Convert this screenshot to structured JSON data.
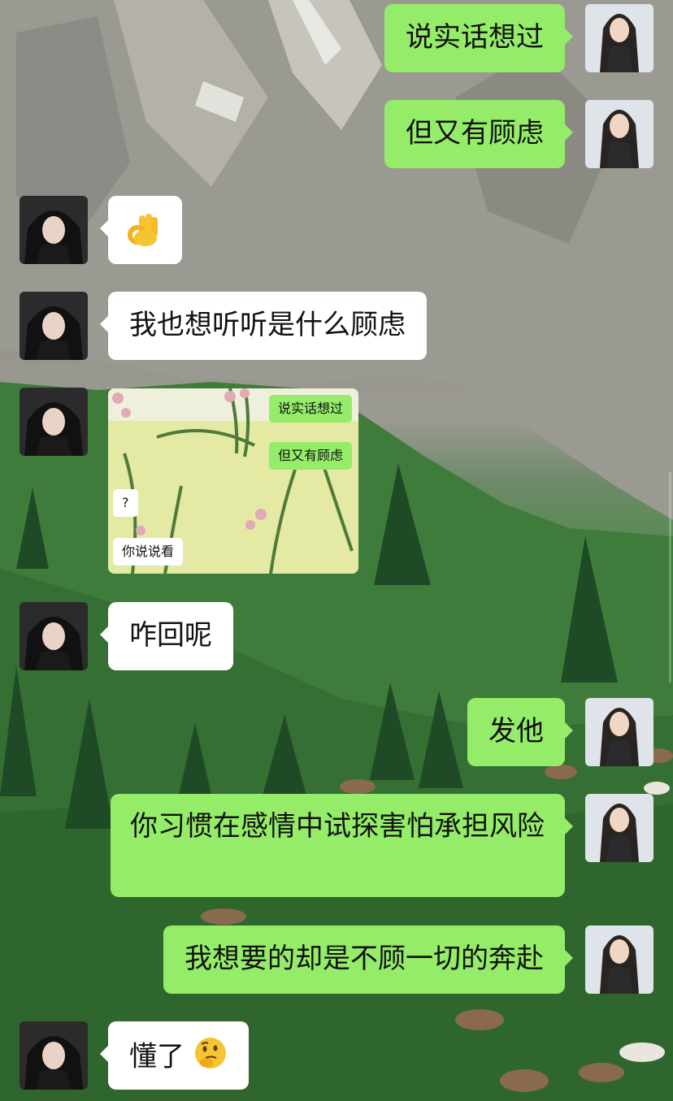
{
  "messages": [
    {
      "side": "out",
      "text": "说实话想过"
    },
    {
      "side": "out",
      "text": "但又有顾虑"
    },
    {
      "side": "in",
      "emoji": "ok-hand"
    },
    {
      "side": "in",
      "text": "我也想听听是什么顾虑"
    },
    {
      "side": "in",
      "image": {
        "bubbles": [
          {
            "side": "out",
            "text": "说实话想过"
          },
          {
            "side": "out",
            "text": "但又有顾虑"
          },
          {
            "side": "in",
            "text": "?"
          },
          {
            "side": "in",
            "text": "你说说看"
          }
        ]
      }
    },
    {
      "side": "in",
      "text": "咋回呢"
    },
    {
      "side": "out",
      "text": "发他"
    },
    {
      "side": "out",
      "text": "你习惯在感情中试探害怕承担风险"
    },
    {
      "side": "out",
      "text": "我想要的却是不顾一切的奔赴"
    },
    {
      "side": "in",
      "text": "懂了",
      "emoji": "thinking-face"
    }
  ],
  "colors": {
    "out_bubble": "#95ec69",
    "in_bubble": "#ffffff"
  }
}
